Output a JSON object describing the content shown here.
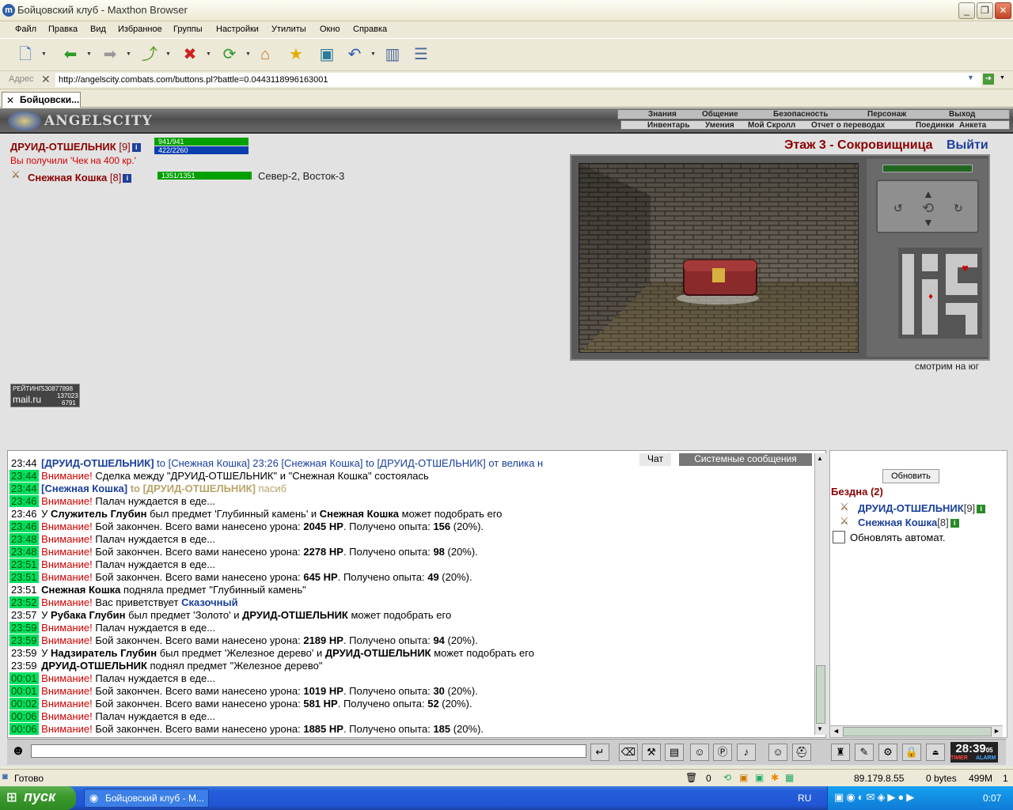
{
  "window": {
    "title": "Бойцовский клуб - Maxthon Browser",
    "min": "_",
    "max": "❐",
    "close": "✕"
  },
  "menu": [
    "Файл",
    "Правка",
    "Вид",
    "Избранное",
    "Группы",
    "Настройки",
    "Утилиты",
    "Окно",
    "Справка"
  ],
  "address": {
    "label": "Адрес",
    "url": "http://angelscity.combats.com/buttons.pl?battle=0.0443118996163001"
  },
  "tab": {
    "label": "Бойцовски..."
  },
  "game": {
    "logo": "ANGELSCITY",
    "nav_top": [
      "Знания",
      "Общение",
      "Безопасность",
      "Персонаж",
      "Выход"
    ],
    "nav_bottom": [
      "Инвентарь",
      "Умения",
      "Мой Скролл",
      "Отчет о переводах",
      "Поединки",
      "Анкета"
    ],
    "character": {
      "name": "ДРУИД-ОТШЕЛЬНИК",
      "level": "[9]",
      "hp": "941/941",
      "mana": "422/2260"
    },
    "received": "Вы получили 'Чек на 400 кр.'",
    "partner": {
      "name": "Снежная Кошка",
      "level": "[8]",
      "hp": "1351/1351"
    },
    "coords": "Север-2, Восток-3",
    "floor": "Этаж 3 - Сокровищница",
    "exit": "Выйти",
    "looking": "смотрим на юг",
    "rating": {
      "label": "РЕЙТИНГ",
      "n1": "530877898",
      "site": "mail.ru",
      "n2": "137023",
      "n3": "6791"
    }
  },
  "chat": {
    "tabs": {
      "chat": "Чат",
      "system": "Системные сообщения"
    },
    "lines": [
      {
        "time": "23:44",
        "hl": false,
        "parts": [
          {
            "c": "blue",
            "t": "[ДРУИД-ОТШЕЛЬНИК]"
          },
          {
            "c": "blue",
            "n": true,
            "t": " to [Снежная Кошка] 23:26 [Снежная Кошка] to [ДРУИД-ОТШЕЛЬНИК] от велика н"
          }
        ]
      },
      {
        "time": "23:44",
        "hl": true,
        "parts": [
          {
            "c": "red",
            "n": true,
            "t": "Внимание!"
          },
          {
            "n": true,
            "t": " Сделка между \"ДРУИД-ОТШЕЛЬНИК\" и \"Снежная Кошка\" состоялась"
          }
        ]
      },
      {
        "time": "23:44",
        "hl": true,
        "parts": [
          {
            "c": "blue",
            "t": "[Снежная Кошка]"
          },
          {
            "c": "gold",
            "t": " to [ДРУИД-ОТШЕЛЬНИК]"
          },
          {
            "c": "gold",
            "n": true,
            "t": " пасиб"
          }
        ]
      },
      {
        "time": "23:46",
        "hl": true,
        "parts": [
          {
            "c": "red",
            "n": true,
            "t": "Внимание!"
          },
          {
            "n": true,
            "t": " Палач нуждается в еде..."
          }
        ]
      },
      {
        "time": "23:46",
        "hl": false,
        "parts": [
          {
            "n": true,
            "t": "У "
          },
          {
            "t": "Служитель Глубин"
          },
          {
            "n": true,
            "t": " был предмет 'Глубинный камень' и "
          },
          {
            "t": "Снежная Кошка"
          },
          {
            "n": true,
            "t": " может подобрать его"
          }
        ]
      },
      {
        "time": "23:46",
        "hl": true,
        "parts": [
          {
            "c": "red",
            "n": true,
            "t": "Внимание!"
          },
          {
            "n": true,
            "t": " Бой закончен. Всего вами нанесено урона: "
          },
          {
            "t": "2045 HP"
          },
          {
            "n": true,
            "t": ". Получено опыта: "
          },
          {
            "t": "156"
          },
          {
            "n": true,
            "t": " (20%)."
          }
        ]
      },
      {
        "time": "23:48",
        "hl": true,
        "parts": [
          {
            "c": "red",
            "n": true,
            "t": "Внимание!"
          },
          {
            "n": true,
            "t": " Палач нуждается в еде..."
          }
        ]
      },
      {
        "time": "23:48",
        "hl": true,
        "parts": [
          {
            "c": "red",
            "n": true,
            "t": "Внимание!"
          },
          {
            "n": true,
            "t": " Бой закончен. Всего вами нанесено урона: "
          },
          {
            "t": "2278 HP"
          },
          {
            "n": true,
            "t": ". Получено опыта: "
          },
          {
            "t": "98"
          },
          {
            "n": true,
            "t": " (20%)."
          }
        ]
      },
      {
        "time": "23:51",
        "hl": true,
        "parts": [
          {
            "c": "red",
            "n": true,
            "t": "Внимание!"
          },
          {
            "n": true,
            "t": " Палач нуждается в еде..."
          }
        ]
      },
      {
        "time": "23:51",
        "hl": true,
        "parts": [
          {
            "c": "red",
            "n": true,
            "t": "Внимание!"
          },
          {
            "n": true,
            "t": " Бой закончен. Всего вами нанесено урона: "
          },
          {
            "t": "645 HP"
          },
          {
            "n": true,
            "t": ". Получено опыта: "
          },
          {
            "t": "49"
          },
          {
            "n": true,
            "t": " (20%)."
          }
        ]
      },
      {
        "time": "23:51",
        "hl": false,
        "parts": [
          {
            "t": "Снежная Кошка"
          },
          {
            "n": true,
            "t": " подняла предмет \"Глубинный камень\""
          }
        ]
      },
      {
        "time": "23:52",
        "hl": true,
        "parts": [
          {
            "c": "red",
            "n": true,
            "t": "Внимание!"
          },
          {
            "n": true,
            "t": " Вас приветствует "
          },
          {
            "c": "blue",
            "t": "Сказочный"
          }
        ]
      },
      {
        "time": "23:57",
        "hl": false,
        "parts": [
          {
            "n": true,
            "t": "У "
          },
          {
            "t": "Рубака Глубин"
          },
          {
            "n": true,
            "t": " был предмет 'Золото' и "
          },
          {
            "t": "ДРУИД-ОТШЕЛЬНИК"
          },
          {
            "n": true,
            "t": " может подобрать его"
          }
        ]
      },
      {
        "time": "23:59",
        "hl": true,
        "parts": [
          {
            "c": "red",
            "n": true,
            "t": "Внимание!"
          },
          {
            "n": true,
            "t": " Палач нуждается в еде..."
          }
        ]
      },
      {
        "time": "23:59",
        "hl": true,
        "parts": [
          {
            "c": "red",
            "n": true,
            "t": "Внимание!"
          },
          {
            "n": true,
            "t": " Бой закончен. Всего вами нанесено урона: "
          },
          {
            "t": "2189 HP"
          },
          {
            "n": true,
            "t": ". Получено опыта: "
          },
          {
            "t": "94"
          },
          {
            "n": true,
            "t": " (20%)."
          }
        ]
      },
      {
        "time": "23:59",
        "hl": false,
        "parts": [
          {
            "n": true,
            "t": "У "
          },
          {
            "t": "Надзиратель Глубин"
          },
          {
            "n": true,
            "t": " был предмет 'Железное дерево' и "
          },
          {
            "t": "ДРУИД-ОТШЕЛЬНИК"
          },
          {
            "n": true,
            "t": " может подобрать его"
          }
        ]
      },
      {
        "time": "23:59",
        "hl": false,
        "parts": [
          {
            "t": "ДРУИД-ОТШЕЛЬНИК"
          },
          {
            "n": true,
            "t": " поднял предмет \"Железное дерево\""
          }
        ]
      },
      {
        "time": "00:01",
        "hl": true,
        "parts": [
          {
            "c": "red",
            "n": true,
            "t": "Внимание!"
          },
          {
            "n": true,
            "t": " Палач нуждается в еде..."
          }
        ]
      },
      {
        "time": "00:01",
        "hl": true,
        "parts": [
          {
            "c": "red",
            "n": true,
            "t": "Внимание!"
          },
          {
            "n": true,
            "t": " Бой закончен. Всего вами нанесено урона: "
          },
          {
            "t": "1019 HP"
          },
          {
            "n": true,
            "t": ". Получено опыта: "
          },
          {
            "t": "30"
          },
          {
            "n": true,
            "t": " (20%)."
          }
        ]
      },
      {
        "time": "00:02",
        "hl": true,
        "parts": [
          {
            "c": "red",
            "n": true,
            "t": "Внимание!"
          },
          {
            "n": true,
            "t": " Бой закончен. Всего вами нанесено урона: "
          },
          {
            "t": "581 HP"
          },
          {
            "n": true,
            "t": ". Получено опыта: "
          },
          {
            "t": "52"
          },
          {
            "n": true,
            "t": " (20%)."
          }
        ]
      },
      {
        "time": "00:06",
        "hl": true,
        "parts": [
          {
            "c": "red",
            "n": true,
            "t": "Внимание!"
          },
          {
            "n": true,
            "t": " Палач нуждается в еде..."
          }
        ]
      },
      {
        "time": "00:06",
        "hl": true,
        "parts": [
          {
            "c": "red",
            "n": true,
            "t": "Внимание!"
          },
          {
            "n": true,
            "t": " Бой закончен. Всего вами нанесено урона: "
          },
          {
            "t": "1885 HP"
          },
          {
            "n": true,
            "t": ". Получено опыта: "
          },
          {
            "t": "185"
          },
          {
            "n": true,
            "t": " (20%)."
          }
        ]
      }
    ]
  },
  "online": {
    "refresh": "Обновить",
    "location": "Бездна (2)",
    "users": [
      {
        "name": "ДРУИД-ОТШЕЛЬНИК",
        "level": "[9]"
      },
      {
        "name": "Снежная Кошка",
        "level": "[8]"
      }
    ],
    "auto_label": "Обновлять автомат."
  },
  "clock": {
    "time": "28:39",
    "sec": "05",
    "timer": "TIMER",
    "alarm": "ALARM"
  },
  "status": {
    "text": "Готово",
    "count": "0",
    "ip": "89.179.8.55",
    "bytes": "0 bytes",
    "mem": "499M",
    "num": "1"
  },
  "taskbar": {
    "start": "пуск",
    "task": "Бойцовский клуб - M...",
    "lang": "RU",
    "time": "0:07"
  }
}
